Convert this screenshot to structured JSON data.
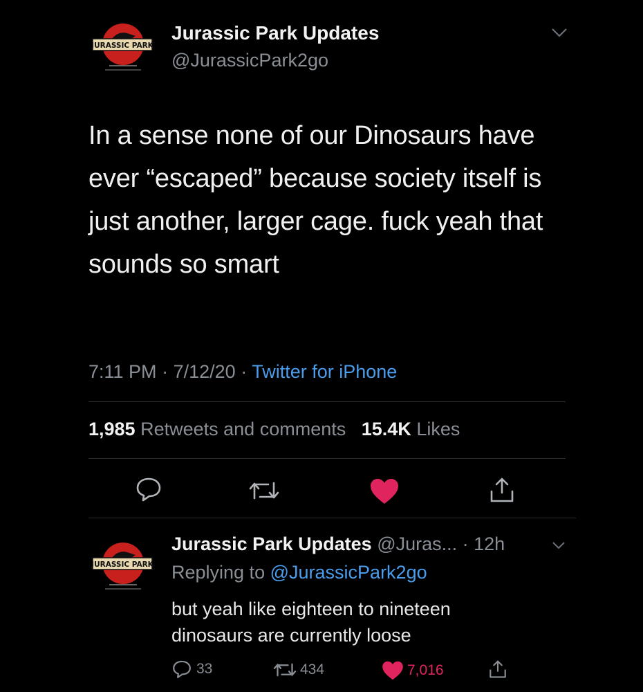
{
  "colors": {
    "background": "#000000",
    "link": "#4a9cec",
    "like": "#e0245e",
    "muted": "#8a8f96"
  },
  "main_tweet": {
    "author_name": "Jurassic Park Updates",
    "author_handle": "@JurassicPark2go",
    "avatar_text": "JURASSIC PARK",
    "text": "In a sense none of our Dinosaurs have ever “escaped” because society itself is just another, larger cage. fuck yeah that sounds so smart",
    "time": "7:11 PM",
    "date": "7/12/20",
    "separator": "·",
    "source": "Twitter for iPhone",
    "retweets_count": "1,985",
    "retweets_label": "Retweets and comments",
    "likes_count": "15.4K",
    "likes_label": "Likes",
    "icons": [
      "chevron-down-icon",
      "reply-icon",
      "retweet-icon",
      "heart-icon",
      "share-icon"
    ]
  },
  "reply_tweet": {
    "author_name": "Jurassic Park Updates",
    "author_handle": "@Juras...",
    "age": "· 12h",
    "replying_label": "Replying to",
    "replying_handle": "@JurassicPark2go",
    "avatar_text": "JURASSIC PARK",
    "text_line1": "but yeah like eighteen to nineteen",
    "text_line2": "dinosaurs are currently loose",
    "reply_count": "33",
    "retweet_count": "434",
    "like_count": "7,016"
  }
}
